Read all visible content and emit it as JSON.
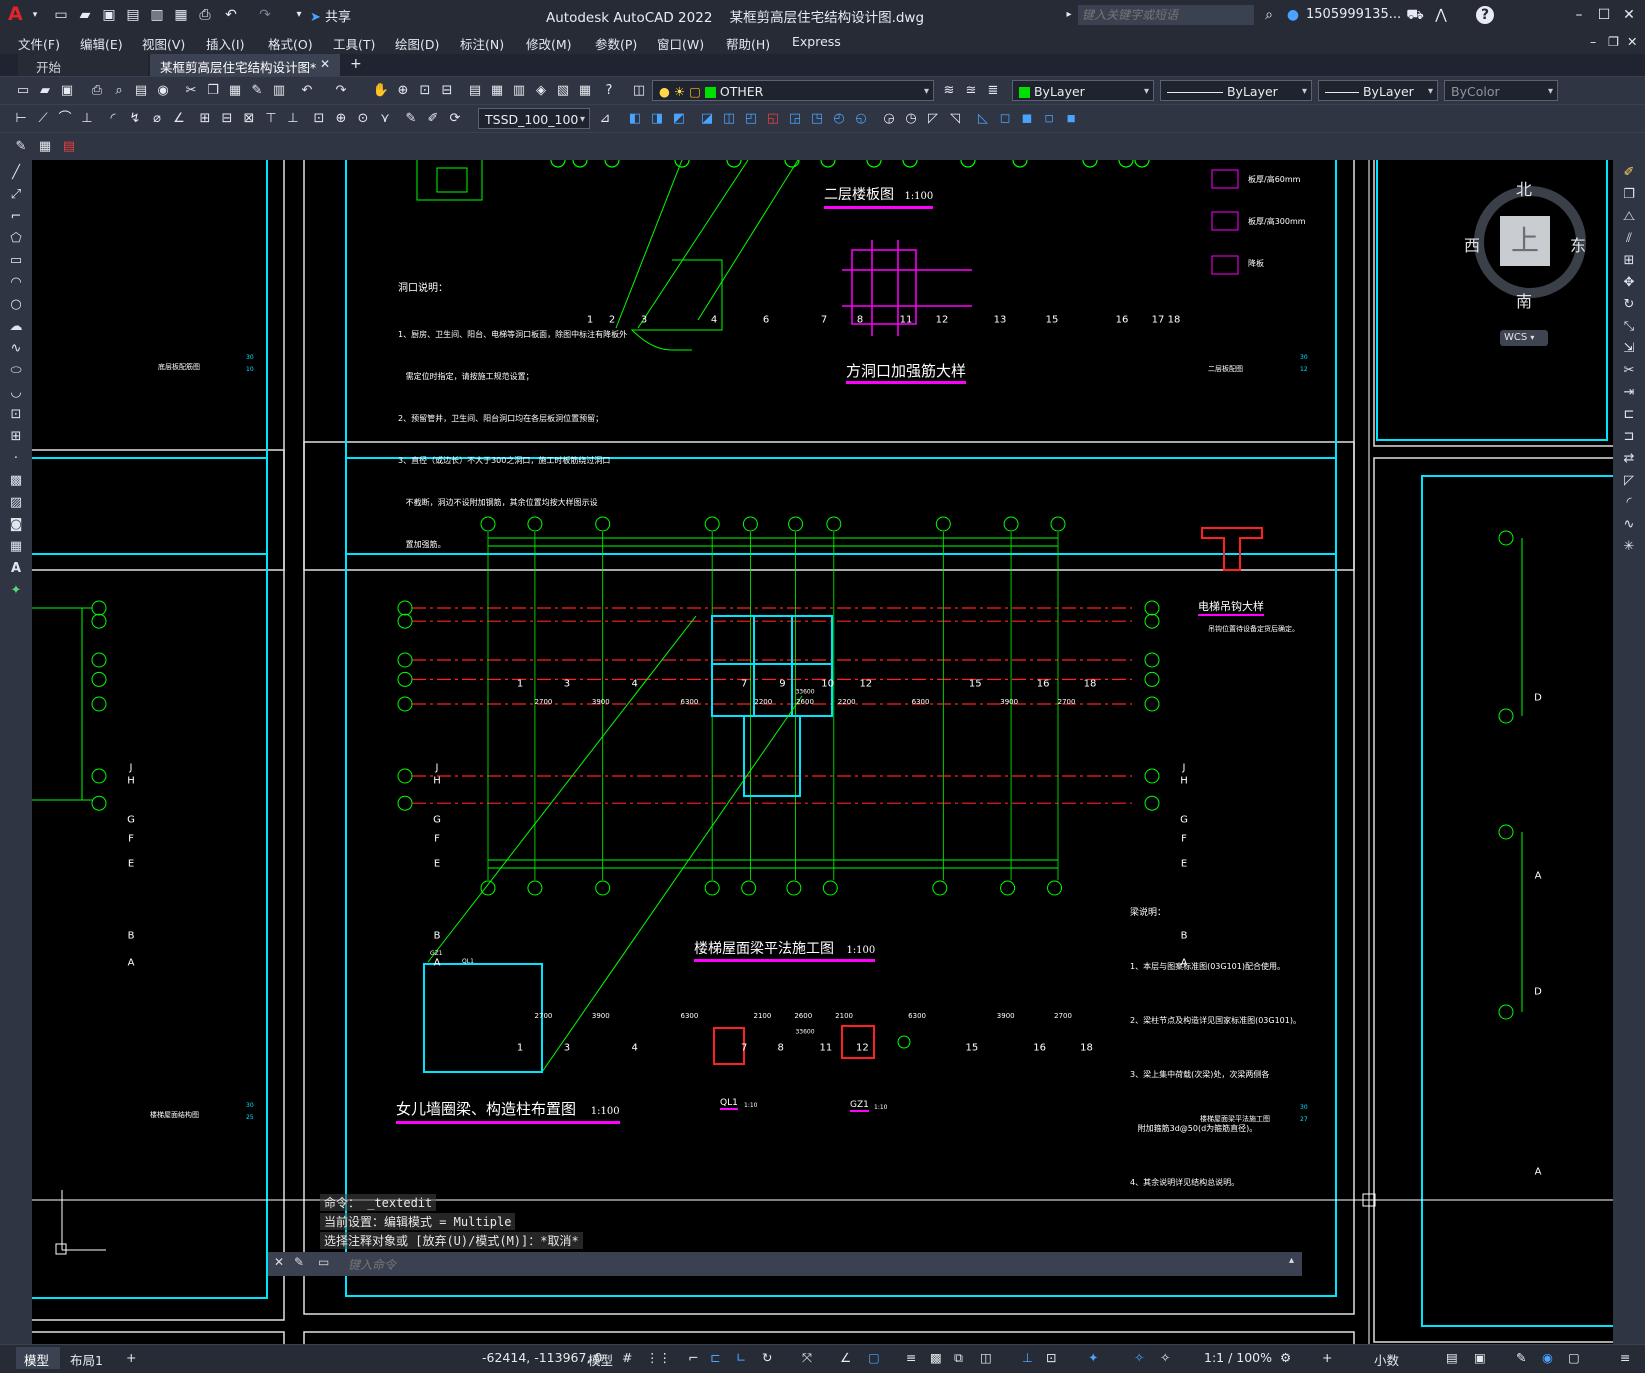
{
  "app": {
    "title": "Autodesk AutoCAD 2022    某框剪高层住宅结构设计图.dwg",
    "share_label": "共享",
    "search_placeholder": "键入关键字或短语",
    "user": "1505999135...",
    "logo": "A"
  },
  "menu": [
    "文件(F)",
    "编辑(E)",
    "视图(V)",
    "插入(I)",
    "格式(O)",
    "工具(T)",
    "绘图(D)",
    "标注(N)",
    "修改(M)",
    "参数(P)",
    "窗口(W)",
    "帮助(H)",
    "Express"
  ],
  "tabs": {
    "start": "开始",
    "active": "某框剪高层住宅结构设计图*",
    "add": "+"
  },
  "toolbar": {
    "layer_name": "OTHER",
    "color": "ByLayer",
    "linetype": "ByLayer",
    "lineweight": "ByLayer",
    "plotstyle": "ByColor",
    "dimstyle": "TSSD_100_100"
  },
  "viewcube": {
    "north": "北",
    "south": "南",
    "west": "西",
    "east": "东",
    "face": "上",
    "wcs": "WCS"
  },
  "drawing": {
    "title_floor2_slab": "二层楼板图",
    "title_floor2_scale": "1:100",
    "title_opening_detail": "方洞口加强筋大样",
    "opening_notes_title": "洞口说明：",
    "opening_notes": [
      "1、厨房、卫生间、阳台、电梯等洞口板面，除图中标注有降板外",
      "   需定位时指定，请按施工规范设置；",
      "2、预留管井，卫生间、阳台洞口均在各层板洞位置预留；",
      "3、直径（或边长）不大于300之洞口，施工时板筋绕过洞口",
      "   不截断，洞边不设附加钢筋，其余位置均按大样图示设",
      "   置加强筋。"
    ],
    "legend": [
      "板厚/高60mm",
      "板厚/高300mm",
      "降板"
    ],
    "title_stair_roof_beam": "楼梯屋面梁平法施工图",
    "title_stair_roof_scale": "1:100",
    "title_parapet": "女儿墙圈梁、构造柱布置图",
    "title_parapet_scale": "1:100",
    "title_elevator_hook": "电梯吊钩大样",
    "elevator_note": "吊钩位置待设备定货后确定。",
    "beam_notes_title": "梁说明：",
    "beam_notes": [
      "1、本层与图案标准图(03G101)配合使用。",
      "2、梁柱节点及构造详见国家标准图(03G101)。",
      "3、梁上集中荷载(次梁)处，次梁两侧各",
      "   附加箍筋3d@50(d为箍筋直径)。",
      "4、其余说明详见结构总说明。"
    ],
    "top_axes": [
      "1",
      "2",
      "3",
      "4",
      "6",
      "7",
      "8",
      "11",
      "12",
      "13",
      "15",
      "16",
      "17",
      "18"
    ],
    "main_axes_x": [
      "1",
      "3",
      "4",
      "7",
      "9",
      "10",
      "12",
      "15",
      "16",
      "18"
    ],
    "bottom_axes_x": [
      "1",
      "3",
      "4",
      "7",
      "8",
      "11",
      "12",
      "15",
      "16",
      "18"
    ],
    "axes_y": [
      "J",
      "H",
      "G",
      "F",
      "E",
      "B",
      "A"
    ],
    "right_axes_y": [
      "D",
      "A",
      "D",
      "A"
    ],
    "dims_top": [
      "2700",
      "3900",
      "6300",
      "2200",
      "2600",
      "2200",
      "6300",
      "3900",
      "2700"
    ],
    "dims_bottom": [
      "2700",
      "3900",
      "6300",
      "2100",
      "2600",
      "2100",
      "6300",
      "3900",
      "2700"
    ],
    "total_dim": "33600",
    "sheet_labels": [
      "底层板配筋图",
      "二层板配图",
      "楼梯屋面结构图",
      "楼梯屋面梁平法施工图"
    ],
    "sheet_numbers": [
      "30",
      "10",
      "30",
      "12",
      "30",
      "25",
      "30",
      "27"
    ],
    "detail_ql1": "QL1",
    "detail_gz1": "GZ1",
    "detail_scale": "1:10",
    "parapet_ql": "QL1",
    "parapet_gz": "GZ1"
  },
  "command": {
    "line1": "命令：  _textedit",
    "line2": "当前设置：编辑模式 = Multiple",
    "line3": "选择注释对象或 [放弃(U)/模式(M)]：*取消*",
    "placeholder": "键入命令"
  },
  "status": {
    "model_tab": "模型",
    "layout_tab": "布局1",
    "add": "+",
    "coords": "-62414, -113967, 0",
    "space": "模型",
    "scale": "1:1 / 100%",
    "units": "小数"
  },
  "colors": {
    "frame": "#00e5ff",
    "axis": "#ff2020",
    "line": "#00ff00",
    "text": "#ffffff",
    "hatch": "#ff00ff"
  }
}
